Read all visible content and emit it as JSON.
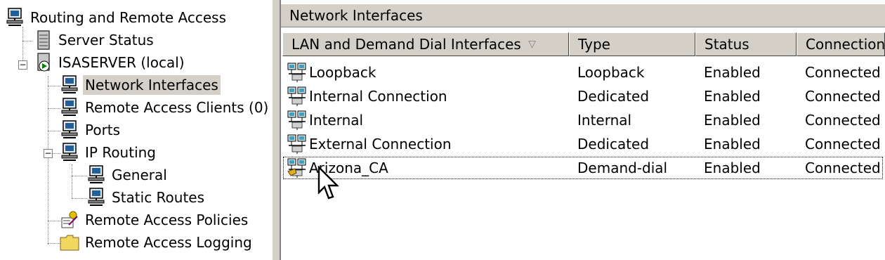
{
  "tree": {
    "root": "Routing and Remote Access",
    "items": [
      {
        "label": "Server Status"
      },
      {
        "label": "ISASERVER (local)"
      },
      {
        "label": "Network Interfaces"
      },
      {
        "label": "Remote Access Clients (0)"
      },
      {
        "label": "Ports"
      },
      {
        "label": "IP Routing"
      },
      {
        "label": "General"
      },
      {
        "label": "Static Routes"
      },
      {
        "label": "Remote Access Policies"
      },
      {
        "label": "Remote Access Logging"
      }
    ],
    "selected": "Network Interfaces"
  },
  "panel": {
    "title": "Network Interfaces",
    "columns": [
      "LAN and Demand Dial Interfaces",
      "Type",
      "Status",
      "Connection"
    ],
    "sort_glyph": "▽",
    "rows": [
      {
        "name": "Loopback",
        "type": "Loopback",
        "status": "Enabled",
        "connection": "Connected",
        "icon": "network-adapter-icon"
      },
      {
        "name": "Internal Connection",
        "type": "Dedicated",
        "status": "Enabled",
        "connection": "Connected",
        "icon": "network-adapter-icon"
      },
      {
        "name": "Internal",
        "type": "Internal",
        "status": "Enabled",
        "connection": "Connected",
        "icon": "network-adapter-icon"
      },
      {
        "name": "External Connection",
        "type": "Dedicated",
        "status": "Enabled",
        "connection": "Connected",
        "icon": "network-adapter-icon"
      },
      {
        "name": "Arizona_CA",
        "type": "Demand-dial",
        "status": "Enabled",
        "connection": "Connected",
        "icon": "demand-dial-icon"
      }
    ]
  }
}
